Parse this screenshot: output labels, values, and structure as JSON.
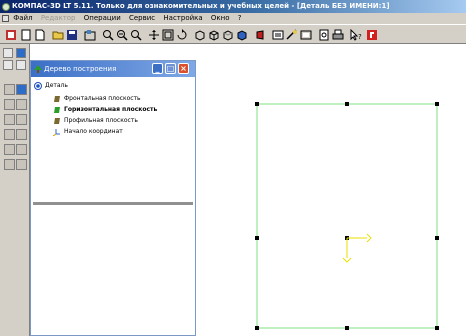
{
  "window": {
    "title": "КОМПАС-3D LT 5.11. Только для ознакомительных и учебных целей - [Деталь БЕЗ ИМЕНИ:1]"
  },
  "menu": {
    "items": [
      {
        "label": "Файл",
        "enabled": true
      },
      {
        "label": "Редактор",
        "enabled": false
      },
      {
        "label": "Операции",
        "enabled": true
      },
      {
        "label": "Сервис",
        "enabled": true
      },
      {
        "label": "Настройка",
        "enabled": true
      },
      {
        "label": "Окно",
        "enabled": true
      },
      {
        "label": "?",
        "enabled": true
      }
    ]
  },
  "tree_panel": {
    "title": "Дерево построения",
    "items": [
      {
        "label": "Деталь",
        "icon": "part-icon"
      },
      {
        "label": "Фронтальная плоскость",
        "icon": "plane-icon"
      },
      {
        "label": "Горизонтальная плоскость",
        "icon": "plane-icon"
      },
      {
        "label": "Профильная плоскость",
        "icon": "plane-icon"
      },
      {
        "label": "Начало координат",
        "icon": "origin-icon"
      }
    ]
  },
  "colors": {
    "sketch_line": "#7fe07f",
    "handle": "#000000",
    "axis": "#e8e000"
  }
}
